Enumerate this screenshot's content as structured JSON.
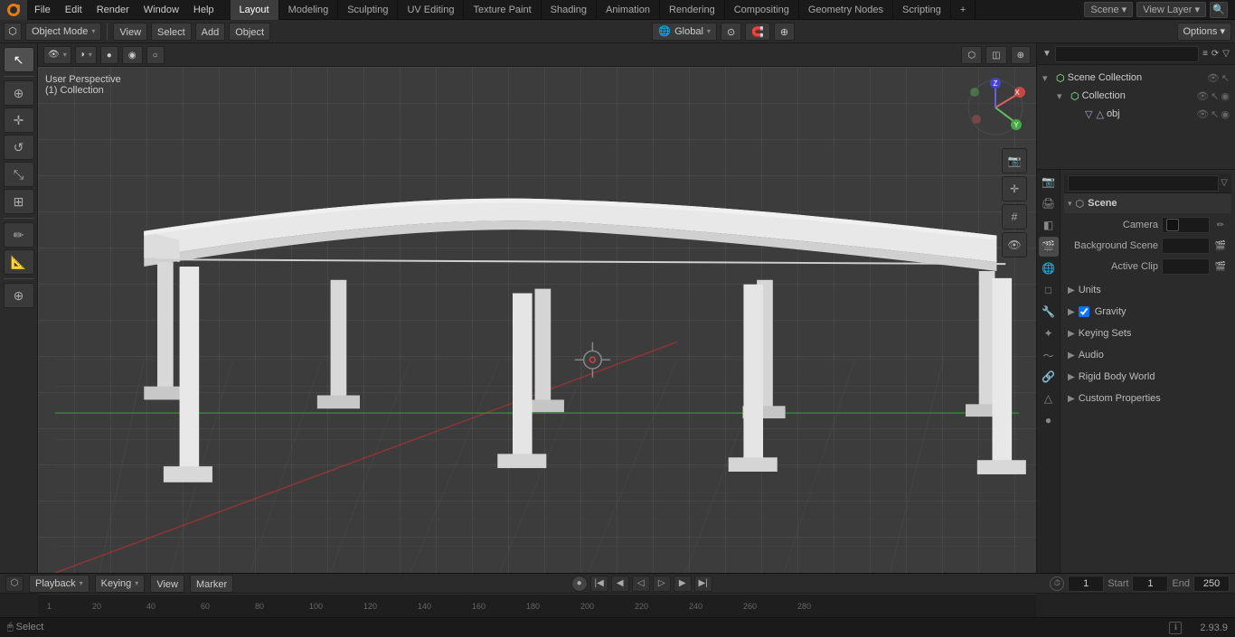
{
  "app": {
    "title": "Blender",
    "version": "2.93.9"
  },
  "top_menu": {
    "items": [
      "File",
      "Edit",
      "Render",
      "Window",
      "Help"
    ]
  },
  "workspace_tabs": {
    "tabs": [
      "Layout",
      "Modeling",
      "Sculpting",
      "UV Editing",
      "Texture Paint",
      "Shading",
      "Animation",
      "Rendering",
      "Compositing",
      "Geometry Nodes",
      "Scripting"
    ],
    "active": "Layout",
    "add_label": "+"
  },
  "top_right": {
    "scene_label": "Scene",
    "view_layer_label": "View Layer",
    "options_label": "Options"
  },
  "second_toolbar": {
    "mode_label": "Object Mode",
    "view_label": "View",
    "select_label": "Select",
    "add_label": "Add",
    "object_label": "Object",
    "transform_label": "Global",
    "options_label": "Options ▾"
  },
  "viewport_info": {
    "perspective": "User Perspective",
    "collection": "(1) Collection"
  },
  "outliner": {
    "search_placeholder": "",
    "scene_collection": "Scene Collection",
    "collection": "Collection",
    "obj": "obj",
    "filter_icon": "▼"
  },
  "properties": {
    "search_placeholder": "",
    "tabs": [
      "render",
      "output",
      "view_layer",
      "scene",
      "world",
      "object",
      "modifiers",
      "particles",
      "physics",
      "constraints",
      "object_data",
      "material",
      "shader"
    ],
    "scene_section": {
      "title": "Scene",
      "camera_label": "Camera",
      "camera_value": "",
      "background_scene_label": "Background Scene",
      "active_clip_label": "Active Clip"
    },
    "units_section": "Units",
    "gravity_section": "Gravity",
    "gravity_checked": true,
    "keying_sets_section": "Keying Sets",
    "audio_section": "Audio",
    "rigid_body_world_section": "Rigid Body World",
    "custom_properties_section": "Custom Properties"
  },
  "timeline": {
    "playback_label": "Playback",
    "keying_label": "Keying",
    "view_label": "View",
    "marker_label": "Marker",
    "frame_current": "1",
    "start_label": "Start",
    "start_value": "1",
    "end_label": "End",
    "end_value": "250",
    "ruler_marks": [
      "1",
      "40",
      "80",
      "120",
      "160",
      "200",
      "240",
      "280"
    ]
  },
  "status_bar": {
    "select_label": "Select",
    "version": "2.93.9"
  },
  "viewport_tools_right": [
    "camera",
    "transform",
    "grid",
    "eye"
  ],
  "ruler": {
    "marks": [
      1,
      20,
      40,
      60,
      80,
      100,
      120,
      140,
      160,
      180,
      200,
      220,
      240,
      260,
      280
    ]
  }
}
